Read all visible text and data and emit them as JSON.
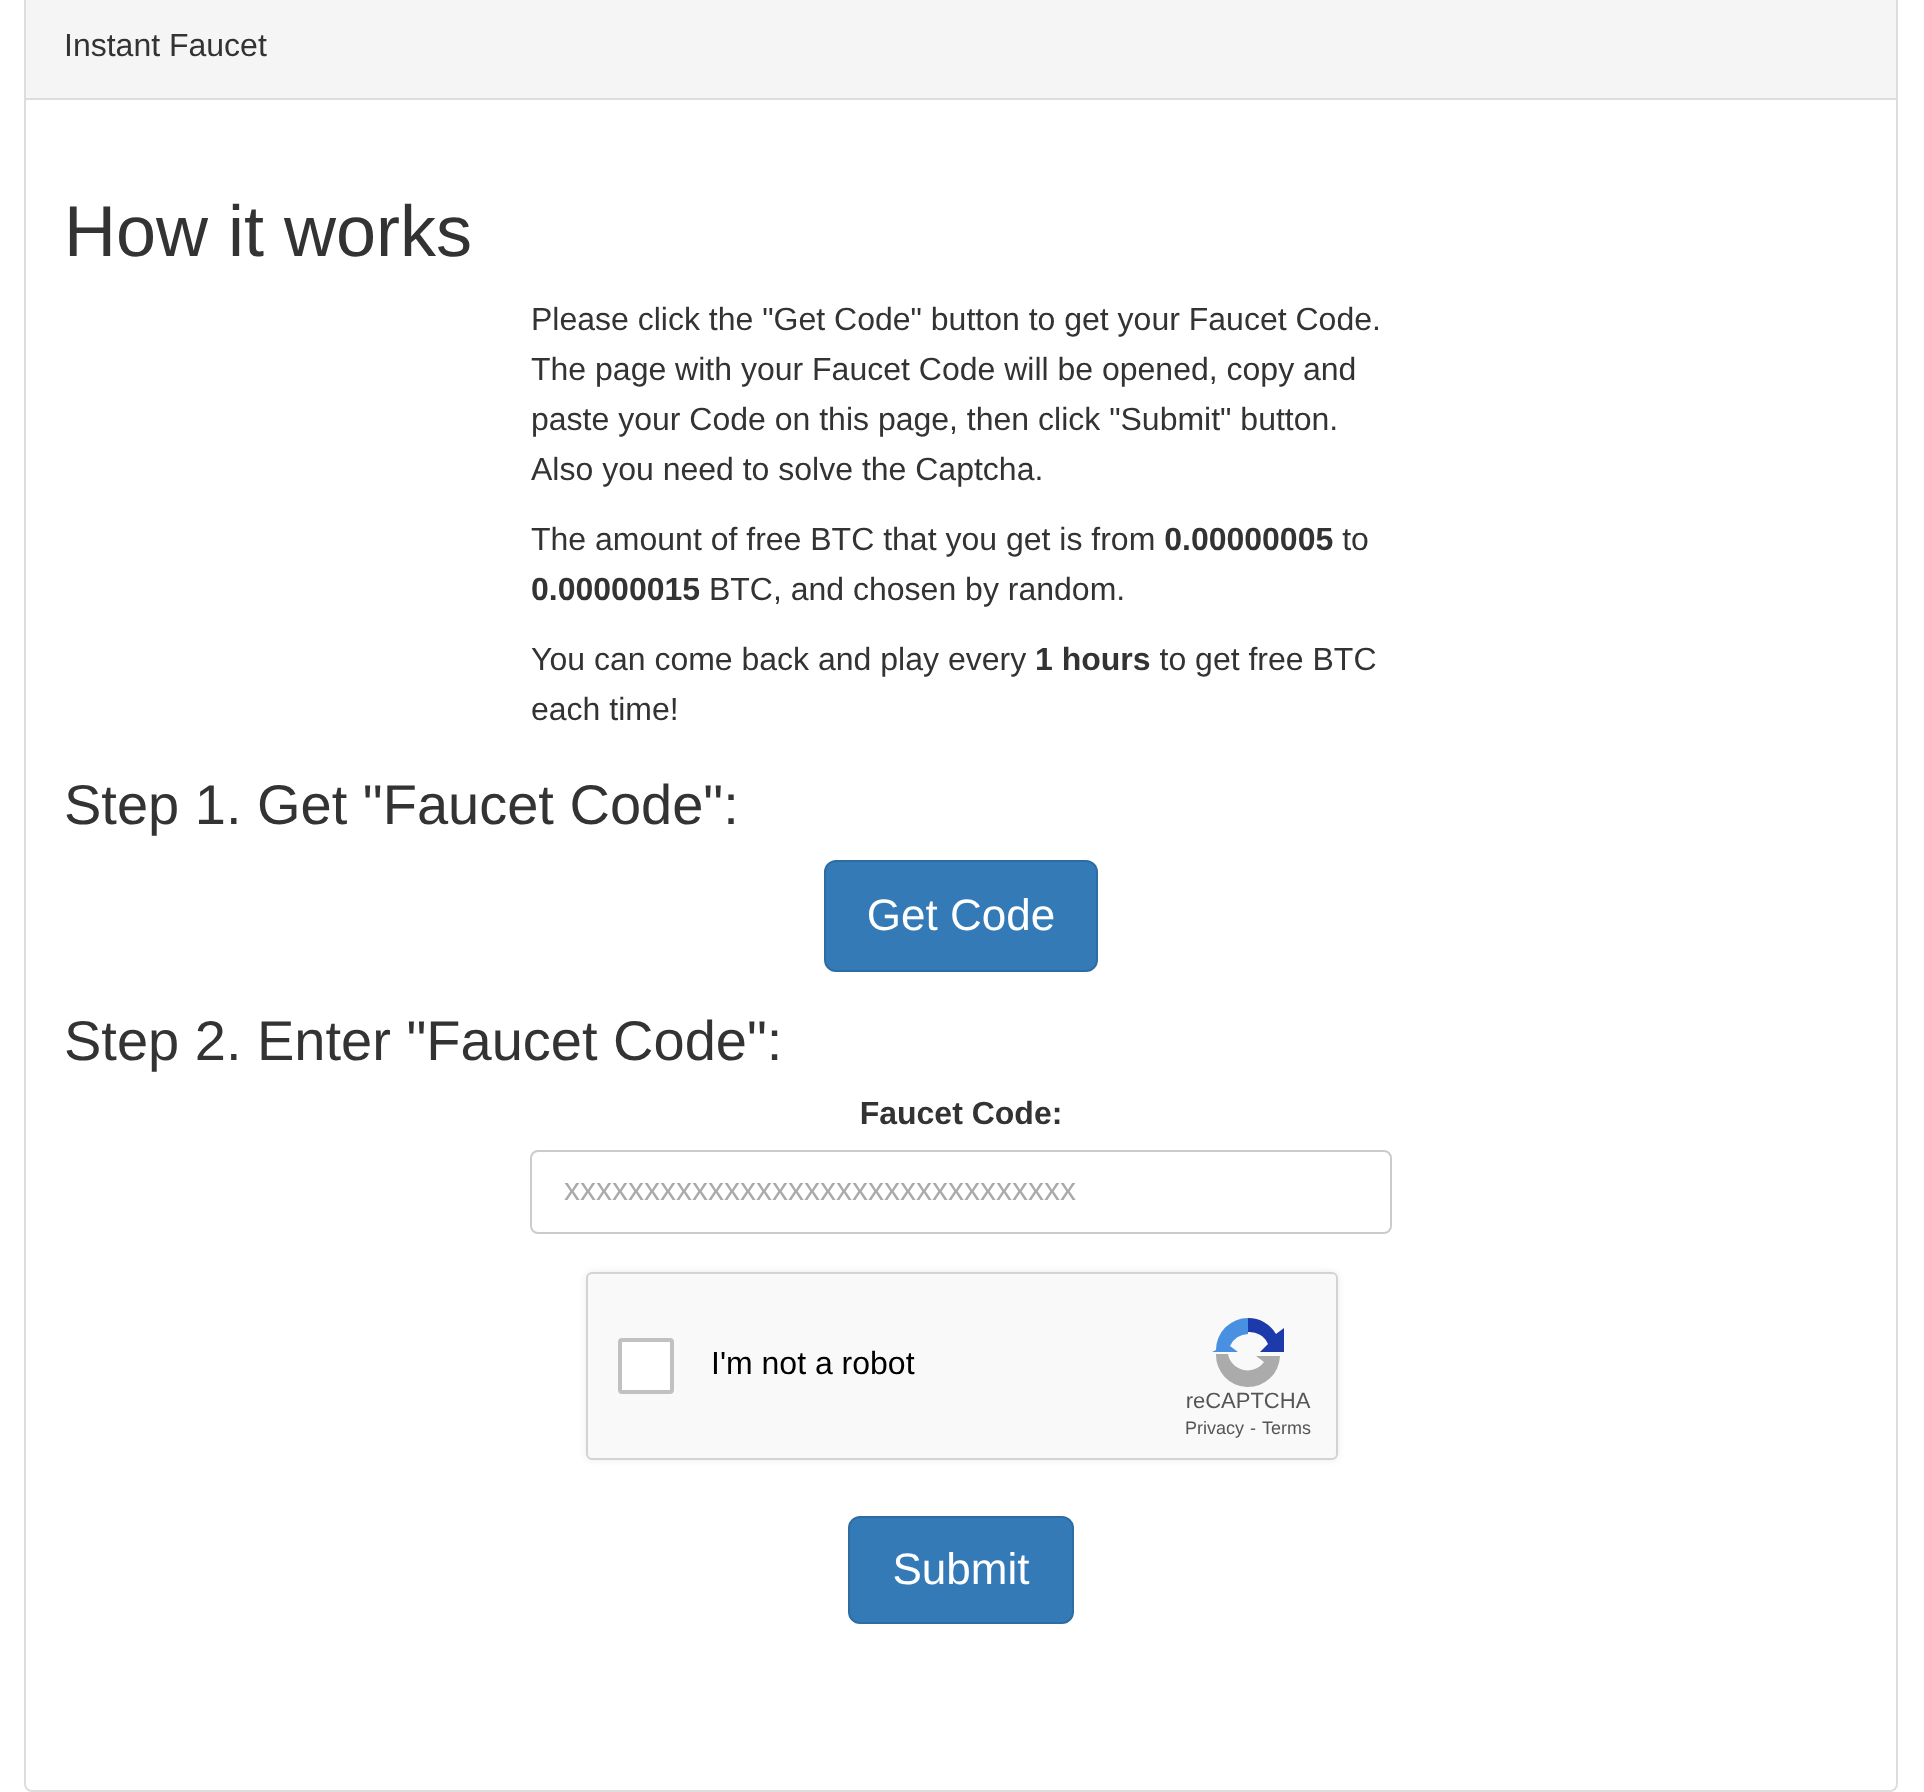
{
  "panel": {
    "title": "Instant Faucet"
  },
  "intro": {
    "heading": "How it works",
    "paragraphs": [
      "Please click the \"Get Code\" button to get your Faucet Code. The page with your Faucet Code will be opened, copy and paste your Code on this page, then click \"Submit\" button. Also you need to solve the Captcha.",
      "The amount of free BTC that you get is from **0.00000005** to **0.00000015** BTC, and chosen by random.",
      "You can come back and play every **1 hours** to get free BTC each time!"
    ]
  },
  "step1": {
    "heading": "Step 1. Get \"Faucet Code\":",
    "button": "Get Code"
  },
  "step2": {
    "heading": "Step 2. Enter \"Faucet Code\":",
    "label": "Faucet Code:",
    "placeholder": "xxxxxxxxxxxxxxxxxxxxxxxxxxxxxxxx"
  },
  "captcha": {
    "label": "I'm not a robot",
    "checked": false,
    "brand": "reCAPTCHA",
    "privacy": "Privacy",
    "separator": "-",
    "terms": "Terms"
  },
  "submit": "Submit"
}
